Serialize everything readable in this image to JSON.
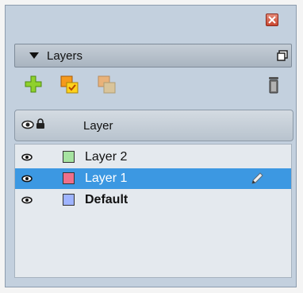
{
  "panel": {
    "title": "Layers"
  },
  "toolbar": {
    "icons": [
      "add-layer-icon",
      "duplicate-layer-icon",
      "merge-layer-icon",
      "delete-layer-icon"
    ]
  },
  "columns": {
    "visibility_icon": "eye-icon",
    "lock_icon": "lock-icon",
    "layer_label": "Layer"
  },
  "layers": [
    {
      "name": "Layer 2",
      "color": "#a6e3a1",
      "selected": false,
      "bold": false
    },
    {
      "name": "Layer 1",
      "color": "#ef6f8a",
      "selected": true,
      "bold": false
    },
    {
      "name": "Default",
      "color": "#9fb4ff",
      "selected": false,
      "bold": true
    }
  ],
  "colors": {
    "selection": "#3c98e2",
    "panel_bg": "#c3d0de"
  }
}
